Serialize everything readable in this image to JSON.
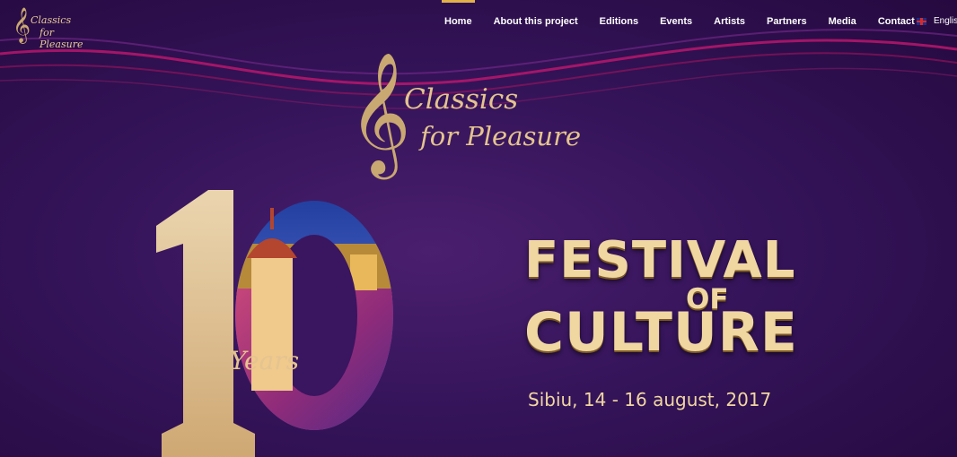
{
  "header": {
    "logo": {
      "line1": "Classics",
      "line2": "for Pleasure",
      "clef_icon": "treble-clef-icon"
    },
    "nav": [
      {
        "label": "Home",
        "active": true
      },
      {
        "label": "About this project",
        "active": false
      },
      {
        "label": "Editions",
        "active": false
      },
      {
        "label": "Events",
        "active": false
      },
      {
        "label": "Artists",
        "active": false
      },
      {
        "label": "Partners",
        "active": false
      },
      {
        "label": "Media",
        "active": false
      },
      {
        "label": "Contact",
        "active": false
      }
    ],
    "language": {
      "label": "English",
      "flag_icon": "uk-flag-icon"
    }
  },
  "hero": {
    "logo": {
      "line1": "Classics",
      "line2": "for Pleasure"
    },
    "years": {
      "numeral": "10",
      "label": "Years"
    },
    "festival": {
      "line1": "FESTIVAL",
      "line2": "OF",
      "line3": "CULTURE",
      "subtitle": "Sibiu, 14 - 16 august, 2017"
    }
  },
  "colors": {
    "background": "#35145a",
    "gold": "#e4c48f",
    "accent_wave": "#c2186e",
    "nav_active": "#e1b24a"
  }
}
